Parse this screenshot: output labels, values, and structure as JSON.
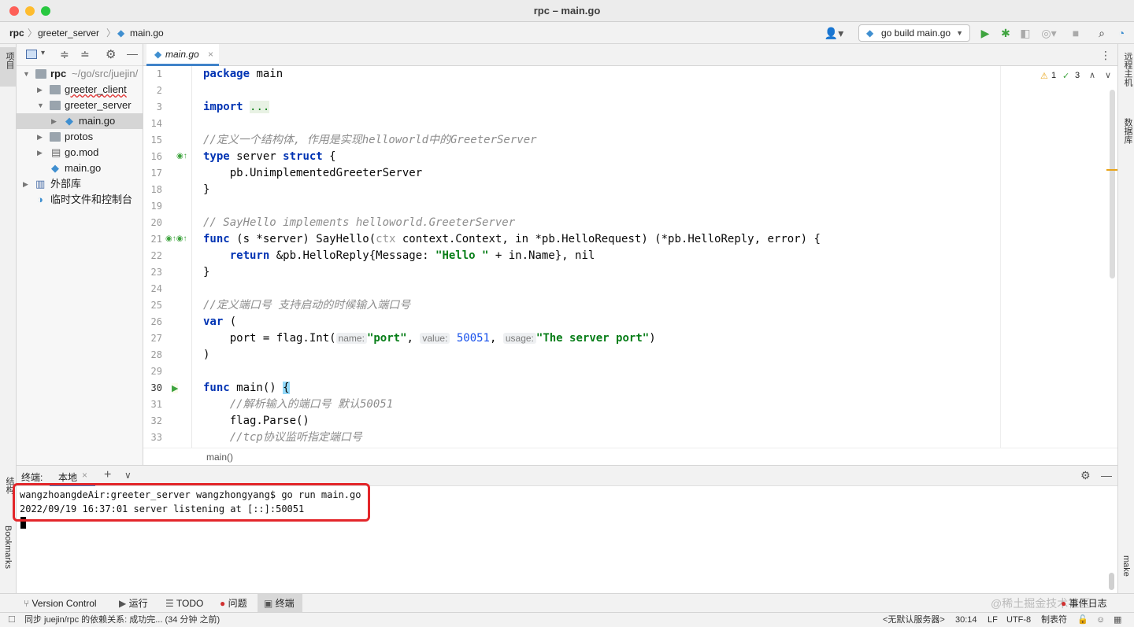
{
  "window": {
    "title": "rpc – main.go"
  },
  "breadcrumbs": [
    "rpc",
    "greeter_server",
    "main.go"
  ],
  "run_config": {
    "label": "go build main.go"
  },
  "project_tree": {
    "root": {
      "name": "rpc",
      "path": "~/go/src/juejin/"
    },
    "items": [
      {
        "label": "greeter_client"
      },
      {
        "label": "greeter_server"
      },
      {
        "label": "main.go"
      },
      {
        "label": "protos"
      },
      {
        "label": "go.mod"
      },
      {
        "label": "main.go"
      },
      {
        "label": "外部库"
      },
      {
        "label": "临时文件和控制台"
      }
    ]
  },
  "left_strip": {
    "project": "项目",
    "structure": "结构",
    "bookmarks": "Bookmarks"
  },
  "right_strip": {
    "remote": "远程主机",
    "database": "数据库",
    "make": "make"
  },
  "editor": {
    "tab_label": "main.go",
    "warnings": "1",
    "checks": "3",
    "line_numbers": [
      "1",
      "2",
      "3",
      "14",
      "15",
      "16",
      "17",
      "18",
      "19",
      "20",
      "21",
      "22",
      "23",
      "24",
      "25",
      "26",
      "27",
      "28",
      "29",
      "30",
      "31",
      "32",
      "33"
    ],
    "code": {
      "l1_kw": "package",
      "l1_rest": " main",
      "l3_kw": "import",
      "l3_fold": "...",
      "l15": "//定义一个结构体, 作用是实现helloworld中的GreeterServer",
      "l16_kw1": "type",
      "l16_mid": " server ",
      "l16_kw2": "struct",
      "l16_end": " {",
      "l17": "    pb.UnimplementedGreeterServer",
      "l18": "}",
      "l20": "// SayHello implements helloworld.GreeterServer",
      "l21_kw": "func",
      "l21_a": " (s *server) SayHello(",
      "l21_ctx": "ctx",
      "l21_b": " context.Context, in *pb.HelloRequest) (*pb.HelloReply, error) {",
      "l22_pre": "    ",
      "l22_kw": "return",
      "l22_a": " &pb.HelloReply{Message: ",
      "l22_str": "\"Hello \"",
      "l22_b": " + in.Name}, nil",
      "l23": "}",
      "l25": "//定义端口号 支持启动的时候输入端口号",
      "l26_kw": "var",
      "l26_rest": " (",
      "l27_a": "    port = flag.Int(",
      "l27_h1": "name:",
      "l27_s1": "\"port\"",
      "l27_c1": ", ",
      "l27_h2": "value:",
      "l27_n": "50051",
      "l27_c2": ", ",
      "l27_h3": "usage:",
      "l27_s2": "\"The server port\"",
      "l27_end": ")",
      "l28": ")",
      "l30_kw": "func",
      "l30_a": " main() ",
      "l30_brace": "{",
      "l31": "    //解析输入的端口号 默认50051",
      "l32": "    flag.Parse()",
      "l33": "    //tcp协议监听指定端口号"
    },
    "breadcrumb": "main()"
  },
  "terminal": {
    "header_label": "终端:",
    "tab_label": "本地",
    "lines": [
      "wangzhoangdeAir:greeter_server wangzhongyang$ go run main.go",
      "2022/09/19 16:37:01 server listening at [::]:50051"
    ]
  },
  "bottom_tabs": [
    "Version Control",
    "运行",
    "TODO",
    "问题",
    "终端"
  ],
  "bottom_right": "事件日志",
  "watermark": "@稀土掘金技术社区",
  "status": {
    "message": "同步 juejin/rpc 的依赖关系: 成功完... (34 分钟 之前)",
    "server": "<无默认服务器>",
    "position": "30:14",
    "line_sep": "LF",
    "encoding": "UTF-8",
    "indent": "制表符"
  },
  "colors": {
    "accent": "#4083c9",
    "highlight_box": "#e3262a",
    "run_green": "#3fa43f"
  }
}
